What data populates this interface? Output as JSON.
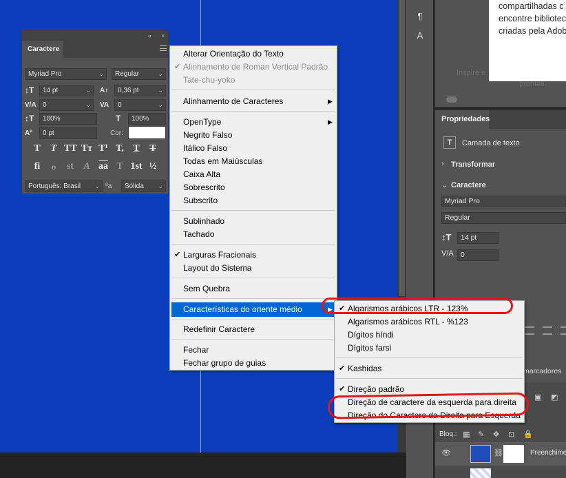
{
  "app": {
    "accent": "#0066d6",
    "annotation_color": "#e01818",
    "canvas_color": "#0b3dbd"
  },
  "char_panel": {
    "tab": "Caractere",
    "collapse_icon": "«",
    "close_icon": "×",
    "font_family": "Myriad Pro",
    "font_style": "Regular",
    "font_size": "14 pt",
    "leading": "0,36 pt",
    "kerning": "0",
    "tracking": "0",
    "v_scale": "100%",
    "h_scale": "100%",
    "baseline": "0 pt",
    "color_label": "Cor:",
    "language": "Português: Brasil",
    "aa_label": "ªa",
    "antialias": "Sólida",
    "style_buttons": [
      "T",
      "T",
      "TT",
      "Tт",
      "T¹",
      "T,",
      "T",
      "T"
    ],
    "opentype_buttons": [
      "fi",
      "ℴ",
      "st",
      "A",
      "aa",
      "T",
      "1st",
      "½"
    ]
  },
  "context_menu": {
    "items": [
      {
        "label": "Alterar Orientação do Texto"
      },
      {
        "label": "Alinhamento de Roman Vertical Padrão",
        "checked": true,
        "disabled": true
      },
      {
        "label": "Tate-chu-yoko",
        "disabled": true
      },
      {
        "label": "Alinhamento de Caracteres",
        "submenu": true
      },
      {
        "label": "OpenType",
        "submenu": true
      },
      {
        "label": "Negrito Falso"
      },
      {
        "label": "Itálico Falso"
      },
      {
        "label": "Todas em Maiúsculas"
      },
      {
        "label": "Caixa Alta"
      },
      {
        "label": "Sobrescrito"
      },
      {
        "label": "Subscrito"
      },
      {
        "label": "Sublinhado"
      },
      {
        "label": "Tachado"
      },
      {
        "label": "Larguras Fracionais",
        "checked": true
      },
      {
        "label": "Layout do Sistema"
      },
      {
        "label": "Sem Quebra"
      },
      {
        "label": "Características do oriente médio",
        "submenu": true,
        "highlighted": true
      },
      {
        "label": "Redefinir Caractere"
      },
      {
        "label": "Fechar"
      },
      {
        "label": "Fechar grupo de guias"
      }
    ]
  },
  "submenu": {
    "items": [
      {
        "label": "Algarismos arábicos LTR - 123%",
        "checked": true
      },
      {
        "label": "Algarismos arábicos RTL - %123"
      },
      {
        "label": "Dígitos híndi"
      },
      {
        "label": "Dígitos farsi"
      },
      {
        "label": "Kashidas",
        "checked": true
      },
      {
        "label": "Direção padrão",
        "checked": true
      },
      {
        "label": "Direção de caractere da esquerda para direita"
      },
      {
        "label": "Direção do Caractere da Direita para Esquerda"
      }
    ]
  },
  "libraries": {
    "lines": [
      "compartilhadas c",
      "encontre bibliotec",
      "criadas pela Adob"
    ],
    "faint": "Inspire e",
    "faint2": "prontas."
  },
  "properties": {
    "tab": "Propriedades",
    "layer_type": "Camada de texto",
    "transform": "Transformar",
    "character": "Caractere",
    "font_family": "Myriad Pro",
    "font_style": "Regular",
    "font_size": "14 pt",
    "tracking": "0"
  },
  "layers": {
    "header": "marcadores",
    "lock_label": "Bloq.:",
    "layer_name": "Preenchime"
  }
}
